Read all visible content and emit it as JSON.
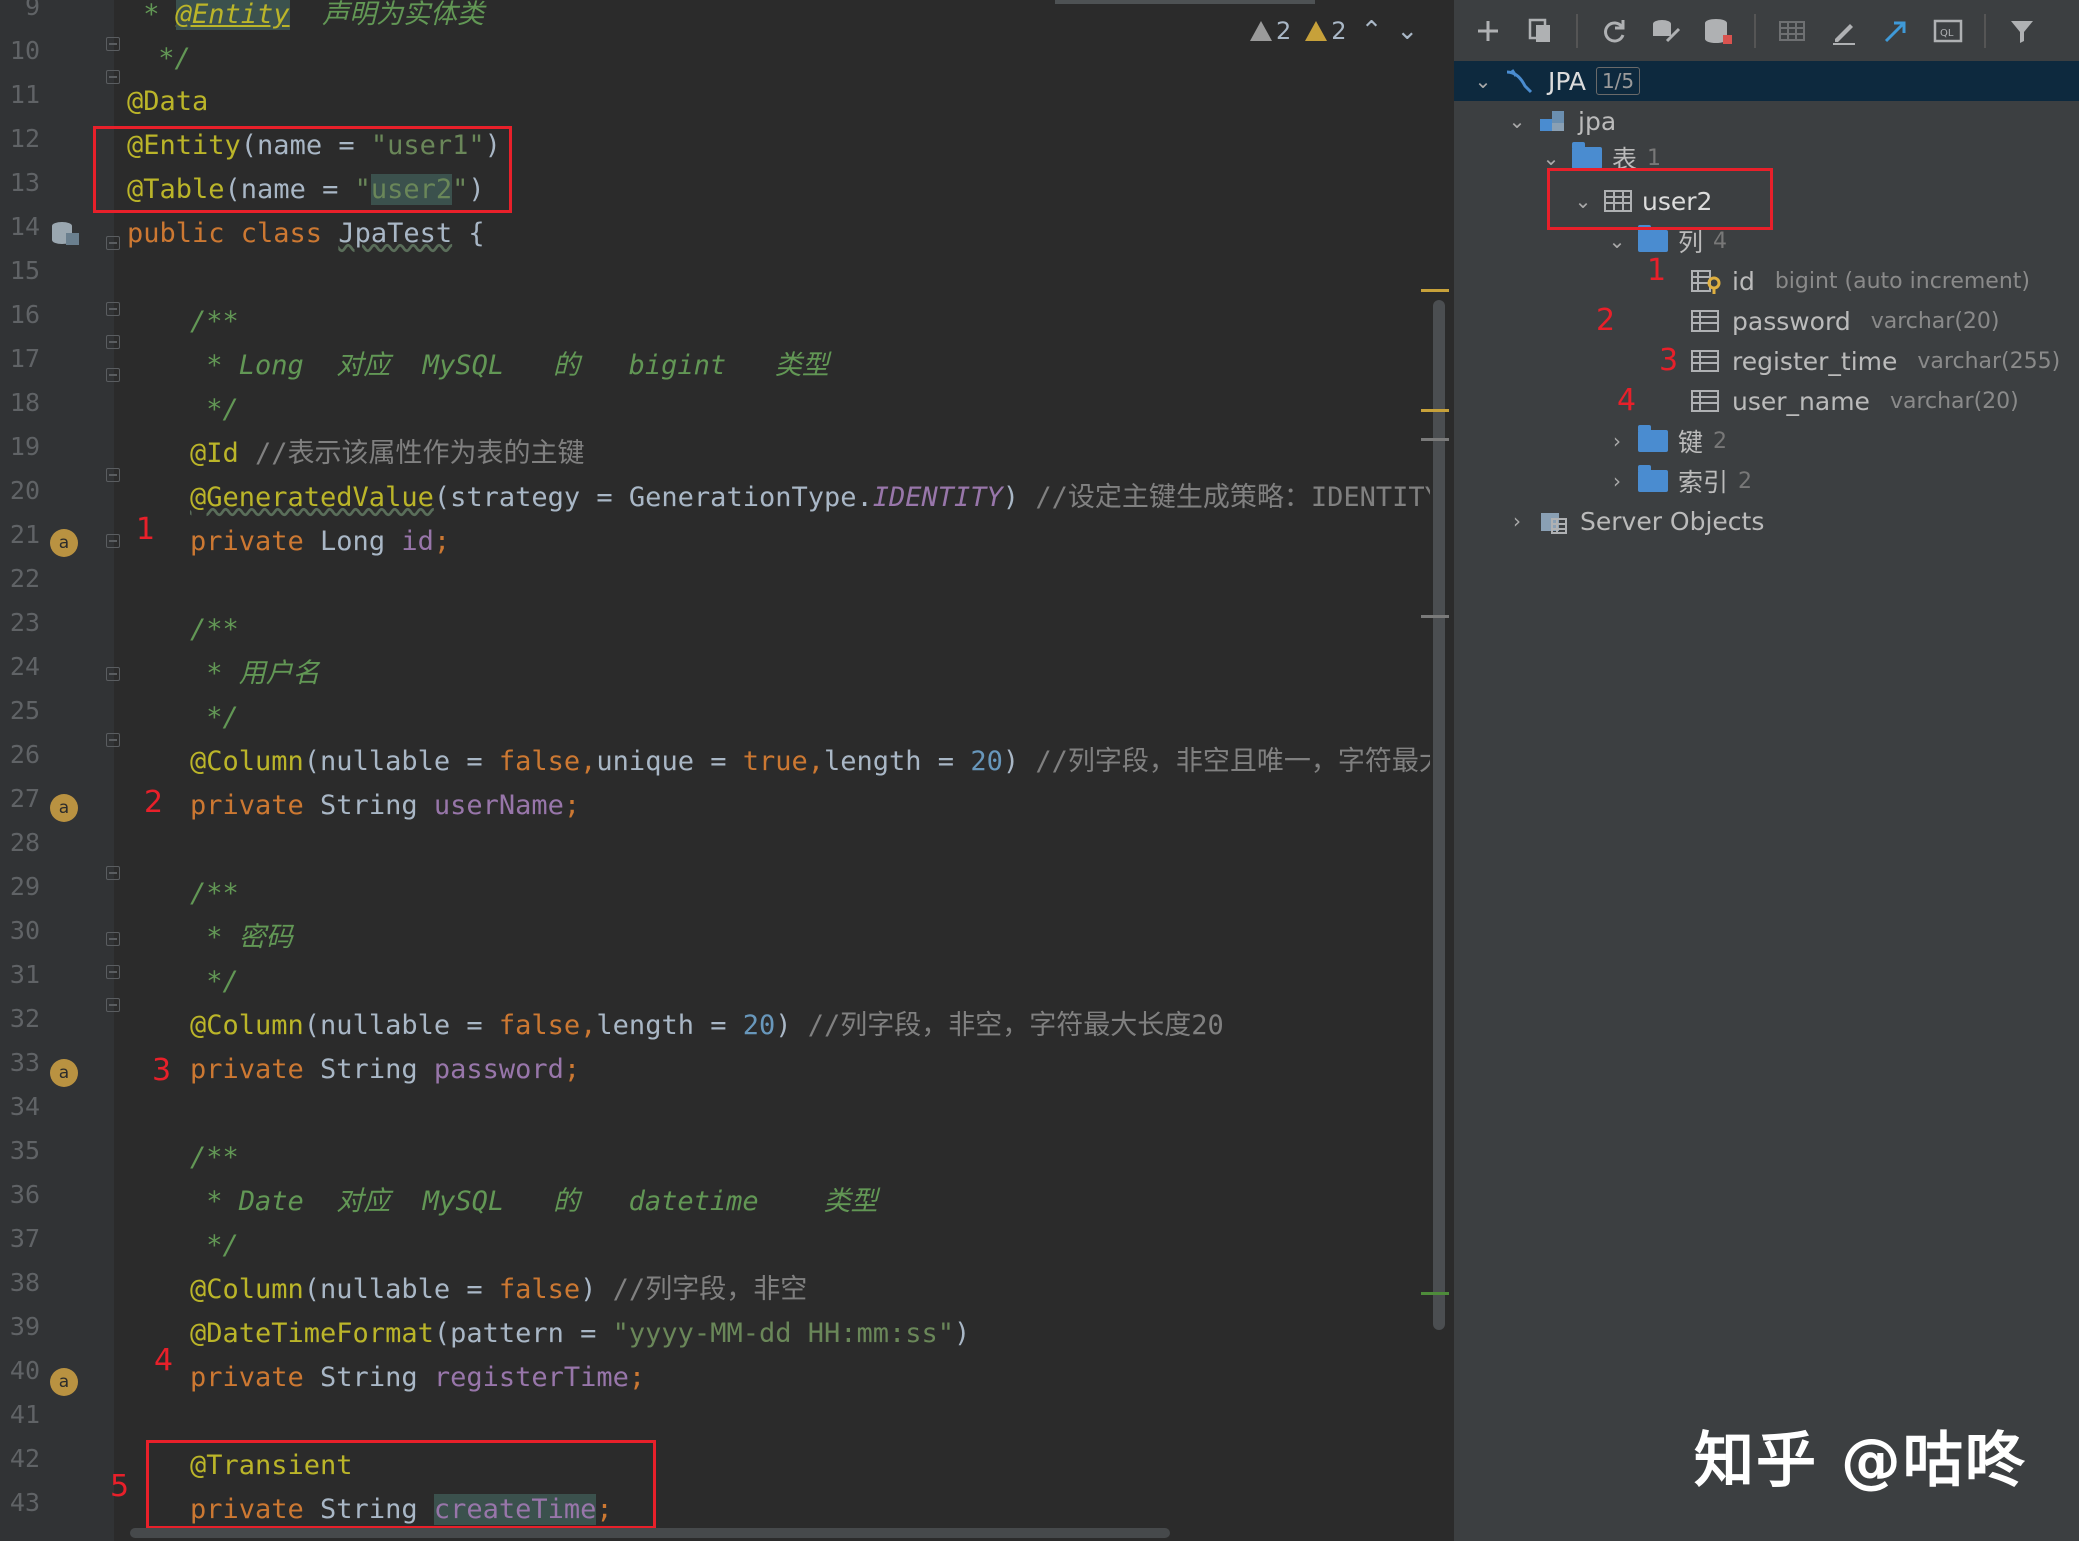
{
  "editor": {
    "line_numbers": [
      "9",
      "10",
      "11",
      "12",
      "13",
      "14",
      "15",
      "16",
      "17",
      "18",
      "19",
      "20",
      "21",
      "22",
      "23",
      "24",
      "25",
      "26",
      "27",
      "28",
      "29",
      "30",
      "31",
      "32",
      "33",
      "34",
      "35",
      "36",
      "37",
      "38",
      "39",
      "40",
      "41",
      "42",
      "43"
    ],
    "lines": {
      "l9": {
        "prefix": " * ",
        "ann": "@Entity",
        "rest": "  声明为实体类"
      },
      "l10": " */",
      "l11": "@Data",
      "l12": {
        "ann": "@Entity",
        "open": "(name = ",
        "str": "\"user1\"",
        "close": ")"
      },
      "l13": {
        "ann": "@Table",
        "open": "(name = ",
        "q1": "\"",
        "str": "user2",
        "q2": "\"",
        "close": ")"
      },
      "l14": {
        "kw": "public class ",
        "name": "JpaTest",
        "rest": " {"
      },
      "l16": "/**",
      "l17": " * Long  对应  MySQL   的   bigint   类型",
      "l18": " */",
      "l19": {
        "ann": "@Id",
        "cmt": " //表示该属性作为表的主键"
      },
      "l20": {
        "ann": "@GeneratedValue",
        "open": "(strategy = GenerationType.",
        "cn": "IDENTITY",
        "close": ")",
        "cmt": " //设定主键生成策略：IDENTITY表示"
      },
      "l21": {
        "kw": "private ",
        "type": "Long ",
        "fld": "id",
        "end": ";"
      },
      "l23": "/**",
      "l24": " * 用户名",
      "l25": " */",
      "l26": {
        "ann": "@Column",
        "p1": "(nullable = ",
        "k1": "false,",
        "p2": "unique = ",
        "k2": "true,",
        "p3": "length = ",
        "n": "20",
        "close": ")",
        "cmt": " //列字段，非空且唯一，字符最大长度"
      },
      "l27": {
        "kw": "private ",
        "type": "String ",
        "fld": "userName",
        "end": ";"
      },
      "l29": "/**",
      "l30": " * 密码",
      "l31": " */",
      "l32": {
        "ann": "@Column",
        "p1": "(nullable = ",
        "k1": "false,",
        "p3": "length = ",
        "n": "20",
        "close": ")",
        "cmt": " //列字段，非空，字符最大长度20"
      },
      "l33": {
        "kw": "private ",
        "type": "String ",
        "fld": "password",
        "end": ";"
      },
      "l35": "/**",
      "l36": " * Date  对应  MySQL   的   datetime    类型",
      "l37": " */",
      "l38": {
        "ann": "@Column",
        "p1": "(nullable = ",
        "k1": "false",
        "close": ")",
        "cmt": " //列字段，非空"
      },
      "l39": {
        "ann": "@DateTimeFormat",
        "open": "(pattern = ",
        "str": "\"yyyy-MM-dd HH:mm:ss\"",
        "close": ")"
      },
      "l40": {
        "kw": "private ",
        "type": "String ",
        "fld": "registerTime",
        "end": ";"
      },
      "l42": "@Transient",
      "l43": {
        "kw": "private ",
        "type": "String ",
        "fld": "createTime",
        "end": ";"
      }
    },
    "markers": [
      "1",
      "2",
      "3",
      "4",
      "5"
    ],
    "gutter_icon_label": "a",
    "warnings": {
      "weak_count": "2",
      "warn_count": "2"
    }
  },
  "db_panel": {
    "toolbar_icons": [
      "add-icon",
      "copy-icon",
      "refresh-icon",
      "sync-schema-icon",
      "data-source-icon",
      "table-icon",
      "edit-icon",
      "jump-icon",
      "query-console-icon",
      "filter-icon"
    ],
    "tree": {
      "root": {
        "label": "JPA",
        "badge": "1/5"
      },
      "schema": "jpa",
      "tables_folder": {
        "label": "表",
        "count": "1"
      },
      "table": "user2",
      "columns_folder": {
        "label": "列",
        "count": "4"
      },
      "columns": [
        {
          "name": "id",
          "type": "bigint (auto increment)",
          "marker": "1"
        },
        {
          "name": "password",
          "type": "varchar(20)",
          "marker": "2"
        },
        {
          "name": "register_time",
          "type": "varchar(255)",
          "marker": "3"
        },
        {
          "name": "user_name",
          "type": "varchar(20)",
          "marker": "4"
        }
      ],
      "keys_folder": {
        "label": "键",
        "count": "2"
      },
      "indexes_folder": {
        "label": "索引",
        "count": "2"
      },
      "server_objects": "Server Objects"
    }
  },
  "watermark": "知乎 @咕咚",
  "colors": {
    "annotation_box": "#e8202a",
    "keyword": "#cc7832",
    "string": "#6a8759",
    "annotation": "#bbb529",
    "field": "#9876aa",
    "doc": "#629755"
  }
}
